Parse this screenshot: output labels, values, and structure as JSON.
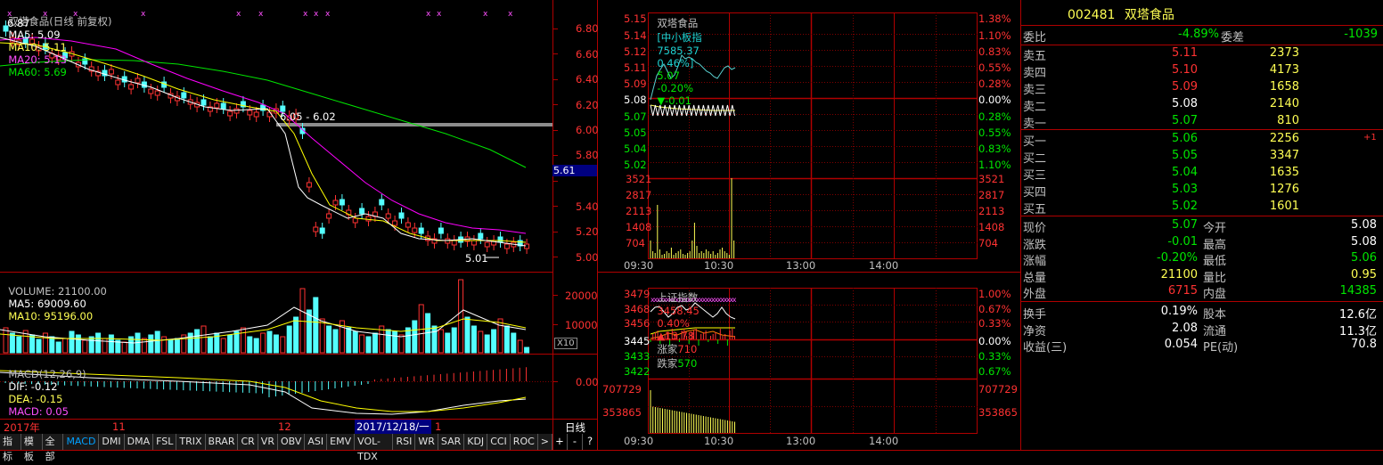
{
  "kline": {
    "title": "双塔食品(日线 前复权)",
    "ma5": "MA5: 5.09",
    "ma10": "MA10: 5.11",
    "ma20": "MA20: 5.13",
    "ma60": "MA60: 5.69",
    "high_label": "6.87",
    "gap_label": "6.05 - 6.02",
    "low_label": "5.01",
    "price_axis": [
      "6.80",
      "6.60",
      "6.40",
      "6.20",
      "6.00",
      "5.80",
      "5.61",
      "5.40",
      "5.20",
      "5.00"
    ],
    "current_price_tag": "5.61",
    "volume_header": "VOLUME: 21100.00",
    "vol_ma5": "MA5: 69009.60",
    "vol_ma10": "MA10: 95196.00",
    "vol_axis": [
      "20000",
      "10000"
    ],
    "vol_unit": "X10",
    "macd_header": "MACD(12,26,9)",
    "macd_dif": "DIF: -0.12",
    "macd_dea": "DEA: -0.15",
    "macd_val": "MACD: 0.05",
    "macd_axis": "0.00",
    "dates": [
      "2017年",
      "11",
      "12",
      "2017/12/18/一",
      "1"
    ],
    "period": "日线",
    "zoom_buttons": [
      "+",
      "-",
      "?"
    ],
    "colors": {
      "up": "#ff3232",
      "down": "#54ffff",
      "ma5": "#ffffff",
      "ma10": "#ffff00",
      "ma20": "#ff00ff",
      "ma60": "#00ff00"
    }
  },
  "tabs": [
    "指标",
    "模板",
    "全部",
    "MACD",
    "DMI",
    "DMA",
    "FSL",
    "TRIX",
    "BRAR",
    "CR",
    "VR",
    "OBV",
    "ASI",
    "EMV",
    "VOL-TDX",
    "RSI",
    "WR",
    "SAR",
    "KDJ",
    "CCI",
    "ROC",
    ">"
  ],
  "active_tab": "MACD",
  "intraday": {
    "name": "双塔食品",
    "index_label": "[中小板指",
    "index_value": "7585.37",
    "index_pct": "0.46%]",
    "price": "5.07",
    "pct": "-0.20%",
    "change": "▼-0.01",
    "left_axis": [
      "5.15",
      "5.14",
      "5.12",
      "5.11",
      "5.09",
      "5.08",
      "5.07",
      "5.05",
      "5.04",
      "5.02"
    ],
    "right_axis": [
      "1.38%",
      "1.10%",
      "0.83%",
      "0.55%",
      "0.28%",
      "0.00%",
      "0.28%",
      "0.55%",
      "0.83%",
      "1.10%"
    ],
    "vol_axis": [
      "3521",
      "2817",
      "2113",
      "1408",
      "704"
    ],
    "times": [
      "09:30",
      "10:30",
      "13:00",
      "14:00"
    ]
  },
  "index": {
    "name": "上证指数",
    "value": "3458.45",
    "pct": "0.40%",
    "change": "▲13.78",
    "up_label": "涨家",
    "up_count": "710",
    "down_label": "跌家",
    "down_count": "570",
    "left_axis": [
      "3479",
      "3468",
      "3456",
      "3445",
      "3433",
      "3422"
    ],
    "right_axis": [
      "1.00%",
      "0.67%",
      "0.33%",
      "0.00%",
      "0.33%",
      "0.67%"
    ],
    "vol_axis": [
      "707729",
      "353865"
    ],
    "times": [
      "09:30",
      "10:30",
      "13:00",
      "14:00"
    ]
  },
  "quote": {
    "code": "002481",
    "name": "双塔食品",
    "weibi_label": "委比",
    "weibi": "-4.89%",
    "weicha_label": "委差",
    "weicha": "-1039",
    "asks": [
      {
        "label": "卖五",
        "price": "5.11",
        "vol": "2373"
      },
      {
        "label": "卖四",
        "price": "5.10",
        "vol": "4173"
      },
      {
        "label": "卖三",
        "price": "5.09",
        "vol": "1658"
      },
      {
        "label": "卖二",
        "price": "5.08",
        "vol": "2140"
      },
      {
        "label": "卖一",
        "price": "5.07",
        "vol": "810"
      }
    ],
    "bids": [
      {
        "label": "买一",
        "price": "5.06",
        "vol": "2256",
        "extra": "+1"
      },
      {
        "label": "买二",
        "price": "5.05",
        "vol": "3347",
        "extra": ""
      },
      {
        "label": "买三",
        "price": "5.04",
        "vol": "1635",
        "extra": ""
      },
      {
        "label": "买四",
        "price": "5.03",
        "vol": "1276",
        "extra": ""
      },
      {
        "label": "买五",
        "price": "5.02",
        "vol": "1601",
        "extra": ""
      }
    ],
    "stats": [
      {
        "l1": "现价",
        "v1": "5.07",
        "l2": "今开",
        "v2": "5.08"
      },
      {
        "l1": "涨跌",
        "v1": "-0.01",
        "l2": "最高",
        "v2": "5.08"
      },
      {
        "l1": "涨幅",
        "v1": "-0.20%",
        "l2": "最低",
        "v2": "5.06"
      },
      {
        "l1": "总量",
        "v1": "21100",
        "l2": "量比",
        "v2": "0.95"
      },
      {
        "l1": "外盘",
        "v1": "6715",
        "l2": "内盘",
        "v2": "14385"
      }
    ],
    "stats2": [
      {
        "l1": "换手",
        "v1": "0.19%",
        "l2": "股本",
        "v2": "12.6亿"
      },
      {
        "l1": "净资",
        "v1": "2.08",
        "l2": "流通",
        "v2": "11.3亿"
      },
      {
        "l1": "收益(三)",
        "v1": "0.054",
        "l2": "PE(动)",
        "v2": "70.8"
      }
    ]
  }
}
